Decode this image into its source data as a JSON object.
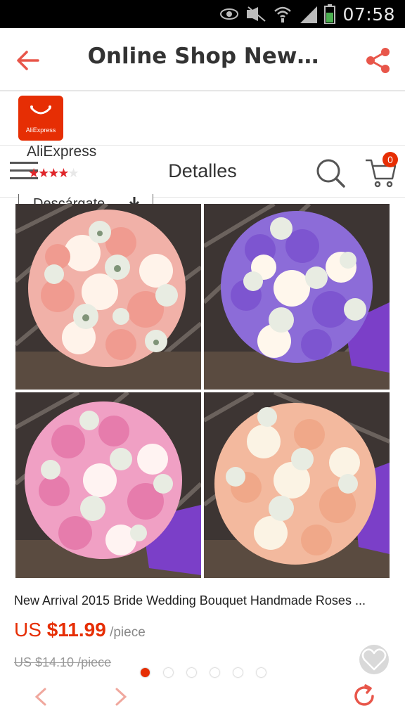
{
  "status_bar": {
    "time": "07:58",
    "icons": [
      "eye-icon",
      "mute-icon",
      "wifi-icon",
      "signal-icon",
      "battery-icon"
    ]
  },
  "app_bar": {
    "title": "Online Shop New…",
    "back_icon": "arrow-left-icon",
    "share_icon": "share-icon"
  },
  "store": {
    "logo_text": "AliExpress",
    "name": "AliExpress",
    "rating_stars": 4.5
  },
  "header": {
    "title": "Detalles",
    "cart_count": "0",
    "download_label": "Descárgate"
  },
  "gallery": {
    "photos": [
      "pink-white-rose-bouquet",
      "purple-white-rose-bouquet",
      "pink-rose-bouquet",
      "peach-white-rose-bouquet"
    ],
    "page_count": 6,
    "active_index": 0
  },
  "product": {
    "title": "New Arrival 2015 Bride Wedding Bouquet Handmade Roses ...",
    "currency": "US ",
    "price": "$11.99",
    "unit": " /piece",
    "old_price": "US $14.10 /piece"
  },
  "colors": {
    "accent": "#e62e04",
    "text": "#333333"
  }
}
